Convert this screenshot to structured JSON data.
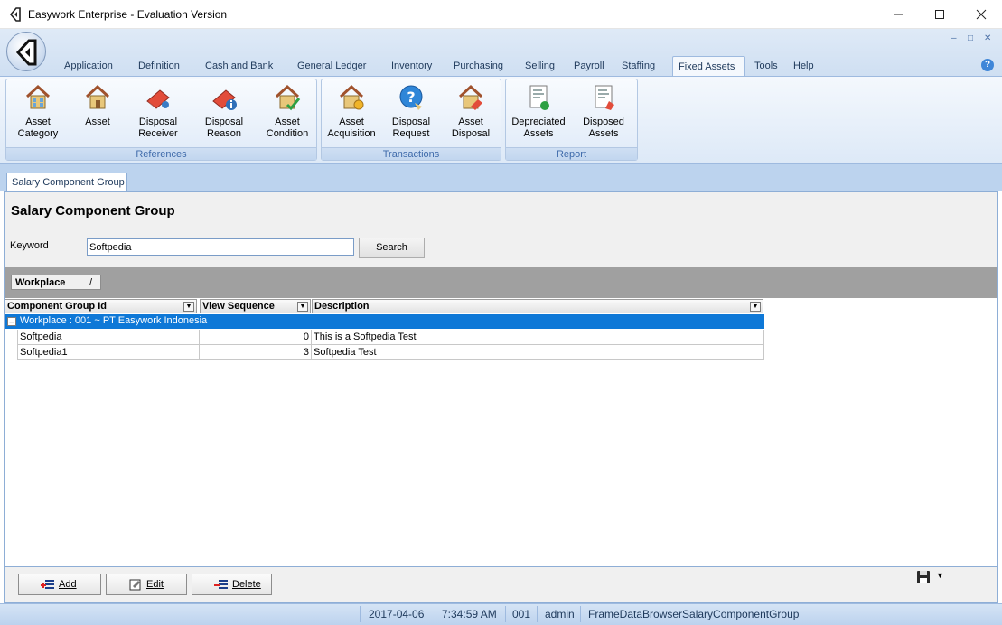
{
  "window": {
    "title": "Easywork Enterprise - Evaluation Version"
  },
  "ribbon": {
    "tabs": [
      "Application",
      "Definition",
      "Cash and Bank",
      "General Ledger",
      "Inventory",
      "Purchasing",
      "Selling",
      "Payroll",
      "Staffing",
      "Fixed Assets",
      "Tools",
      "Help"
    ],
    "active_tab": "Fixed Assets",
    "groups": [
      {
        "label": "References",
        "buttons": [
          "Asset\nCategory",
          "Asset",
          "Disposal\nReceiver",
          "Disposal\nReason",
          "Asset\nCondition"
        ]
      },
      {
        "label": "Transactions",
        "buttons": [
          "Asset\nAcquisition",
          "Disposal\nRequest",
          "Asset\nDisposal"
        ]
      },
      {
        "label": "Report",
        "buttons": [
          "Depreciated\nAssets",
          "Disposed\nAssets"
        ]
      }
    ]
  },
  "document": {
    "tab_label": "Salary Component Group",
    "page_title": "Salary Component Group",
    "keyword_label": "Keyword",
    "keyword_value": "Softpedia",
    "search_label": "Search"
  },
  "grid": {
    "group_by_chip": "Workplace",
    "group_by_slash": "/",
    "columns": [
      "Component Group Id",
      "View Sequence",
      "Description"
    ],
    "group_row": "Workplace : 001 ~ PT Easywork Indonesia",
    "rows": [
      {
        "id": "Softpedia",
        "seq": "0",
        "desc": "This is a Softpedia Test"
      },
      {
        "id": "Softpedia1",
        "seq": "3",
        "desc": "Softpedia Test"
      }
    ]
  },
  "actions": {
    "add": "Add",
    "edit": "Edit",
    "delete": "Delete"
  },
  "status": {
    "date": "2017-04-06",
    "time": "7:34:59 AM",
    "code": "001",
    "user": "admin",
    "frame": "FrameDataBrowserSalaryComponentGroup"
  },
  "colors": {
    "accent": "#0e78d7",
    "ribbon": "#dfeaf7",
    "status": "#bcd2ee"
  }
}
